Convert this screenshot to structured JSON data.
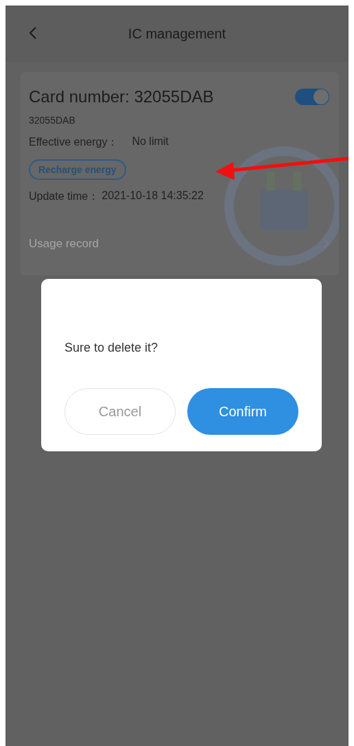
{
  "header": {
    "title": "IC management"
  },
  "card": {
    "title": "Card number: 32055DAB",
    "subtitle": "32055DAB",
    "enabled": true,
    "energy": {
      "label": "Effective energy：",
      "value": "No limit"
    },
    "recharge_button": "Recharge energy",
    "update": {
      "label": "Update time：",
      "value": "2021-10-18 14:35:22"
    },
    "usage_record": "Usage record"
  },
  "dialog": {
    "message": "Sure to delete it?",
    "buttons": [
      {
        "label": "Cancel",
        "kind": "secondary"
      },
      {
        "label": "Confirm",
        "kind": "primary"
      }
    ]
  }
}
